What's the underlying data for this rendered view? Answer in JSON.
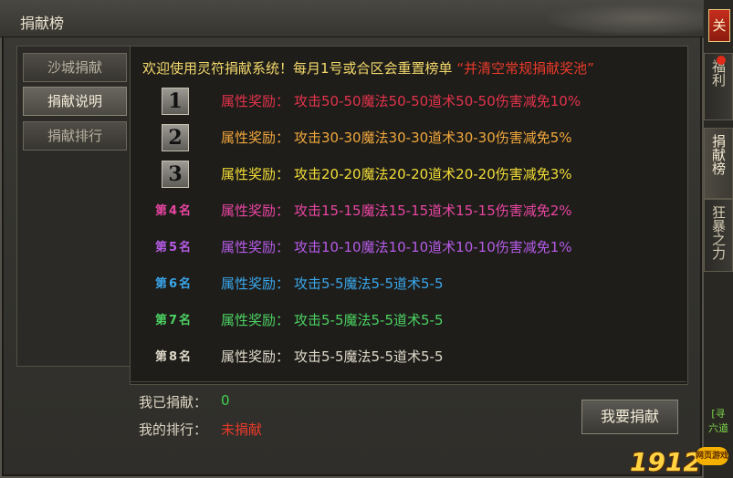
{
  "window": {
    "title": "捐献榜",
    "close_label": "关"
  },
  "side_tabs": [
    {
      "label": "福利"
    },
    {
      "label": "捐献榜"
    },
    {
      "label": "狂暴之力"
    }
  ],
  "side_extra": {
    "text1": "[寻",
    "text2": "六道"
  },
  "nav": [
    {
      "label": "沙城捐献"
    },
    {
      "label": "捐献说明"
    },
    {
      "label": "捐献排行"
    }
  ],
  "notice": {
    "text": "欢迎使用灵符捐献系统！每月1号或合区会重置榜单",
    "red_text": "“并清空常规捐献奖池”"
  },
  "ranks": [
    {
      "badge": "1",
      "label": "属性奖励：",
      "reward": "攻击50-50魔法50-50道术50-50伤害减免10%",
      "color": "#e2334b"
    },
    {
      "badge": "2",
      "label": "属性奖励：",
      "reward": "攻击30-30魔法30-30道术30-30伤害减免5%",
      "color": "#f1a73c"
    },
    {
      "badge": "3",
      "label": "属性奖励：",
      "reward": "攻击20-20魔法20-20道术20-20伤害减免3%",
      "color": "#f2dd37"
    },
    {
      "rank": "第4名",
      "label": "属性奖励：",
      "reward": "攻击15-15魔法15-15道术15-15伤害减免2%",
      "color": "#e845a1"
    },
    {
      "rank": "第5名",
      "label": "属性奖励：",
      "reward": "攻击10-10魔法10-10道术10-10伤害减免1%",
      "color": "#b55be6"
    },
    {
      "rank": "第6名",
      "label": "属性奖励：",
      "reward": "攻击5-5魔法5-5道术5-5",
      "color": "#3aa6ea"
    },
    {
      "rank": "第7名",
      "label": "属性奖励：",
      "reward": "攻击5-5魔法5-5道术5-5",
      "color": "#4cd162"
    },
    {
      "rank": "第8名",
      "label": "属性奖励：",
      "reward": "攻击5-5魔法5-5道术5-5",
      "color": "#ddd8c8"
    }
  ],
  "stats": {
    "donated_label": "我已捐献：",
    "donated_value": "0",
    "rank_label": "我的排行：",
    "rank_value": "未捐献"
  },
  "donate_button": "我要捐献",
  "logo": {
    "text": "1912",
    "sub": "网页游戏"
  },
  "colors": {
    "gold": "#f4d96b",
    "red": "#e83a2a",
    "green": "#3fd34e"
  }
}
